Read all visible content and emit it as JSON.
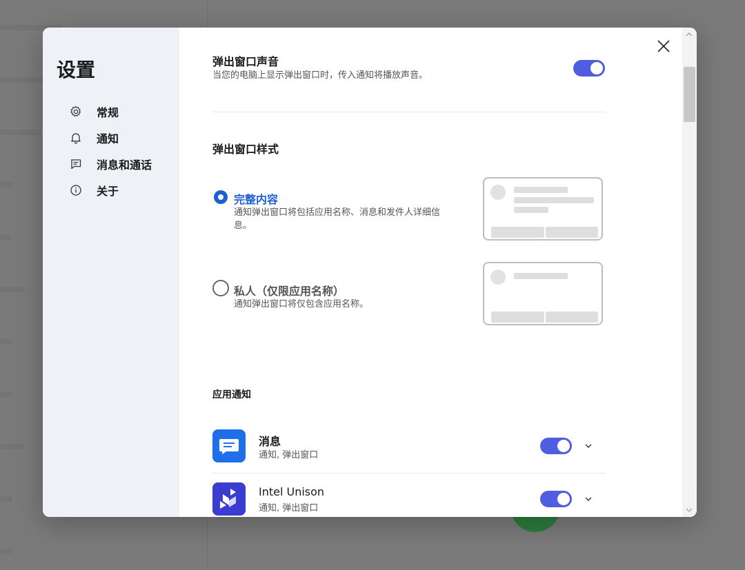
{
  "sidebar": {
    "title": "设置",
    "items": [
      {
        "label": "常规",
        "icon": "gear-icon"
      },
      {
        "label": "通知",
        "icon": "bell-icon"
      },
      {
        "label": "消息和通话",
        "icon": "message-icon"
      },
      {
        "label": "关于",
        "icon": "info-icon"
      }
    ]
  },
  "popup_sound": {
    "title": "弹出窗口声音",
    "desc": "当您的电脑上显示弹出窗口时，传入通知将播放声音。",
    "enabled": true
  },
  "popup_style": {
    "title": "弹出窗口样式",
    "options": [
      {
        "label": "完整内容",
        "desc": "通知弹出窗口将包括应用名称、消息和发件人详细信息。",
        "selected": true
      },
      {
        "label": "私人（仅限应用名称）",
        "desc": "通知弹出窗口将仅包含应用名称。",
        "selected": false
      }
    ]
  },
  "app_notifications": {
    "title": "应用通知",
    "apps": [
      {
        "name": "消息",
        "sub": "通知, 弹出窗口",
        "enabled": true,
        "icon": "messages-app-icon"
      },
      {
        "name": "Intel Unison",
        "sub": "通知, 弹出窗口",
        "enabled": true,
        "icon": "intel-unison-icon"
      }
    ]
  },
  "colors": {
    "accent": "#4f5ee0",
    "radio_selected": "#1f5fd6",
    "sidebar_bg": "#eef2f6"
  }
}
